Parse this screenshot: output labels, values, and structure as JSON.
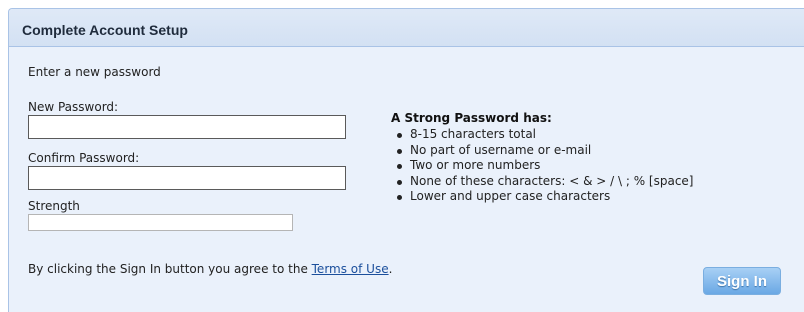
{
  "panel": {
    "title": "Complete Account Setup"
  },
  "form": {
    "instruction": "Enter a new password",
    "new_password": {
      "label": "New Password:",
      "value": ""
    },
    "confirm_password": {
      "label": "Confirm Password:",
      "value": ""
    },
    "strength": {
      "label": "Strength",
      "level": 0
    }
  },
  "rules": {
    "title": "A Strong Password has:",
    "items": [
      "8-15 characters total",
      "No part of username or e-mail",
      "Two or more numbers",
      "None of these characters: < & > / \\ ; % [space]",
      "Lower and upper case characters"
    ]
  },
  "terms": {
    "prefix": "By clicking the Sign In button you agree to the ",
    "link_text": "Terms of Use",
    "suffix": "."
  },
  "actions": {
    "sign_in_label": "Sign In"
  }
}
